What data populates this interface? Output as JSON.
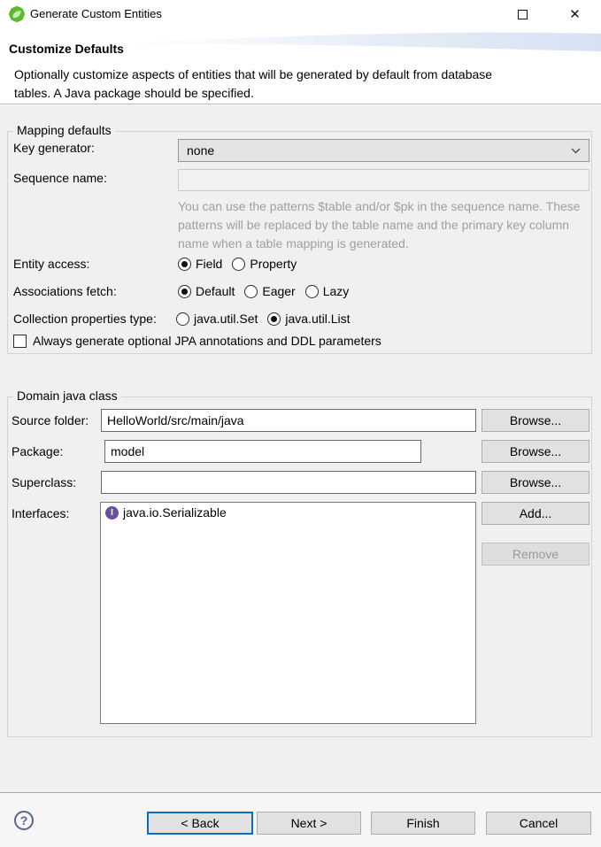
{
  "window": {
    "title": "Generate Custom Entities"
  },
  "icons": {
    "app_icon": "spring-logo",
    "maximize_icon": "Maximize window square",
    "close_icon": "✕",
    "dropdown_chevron_icon": "chevron-down",
    "help_icon": "?",
    "interface_icon_letter": "I"
  },
  "header": {
    "title": "Customize Defaults",
    "description": "Optionally customize aspects of entities that will be generated by default from database tables. A Java package should be specified."
  },
  "mapping_defaults": {
    "legend": "Mapping defaults",
    "key_generator": {
      "label": "Key generator:",
      "value": "none"
    },
    "sequence_name": {
      "label": "Sequence name:",
      "value": "",
      "enabled": false
    },
    "sequence_hint": "You can use the patterns $table and/or $pk in the sequence name. These patterns will be replaced by the table name and the primary key column name when a table mapping is generated.",
    "entity_access": {
      "label": "Entity access:",
      "options": [
        {
          "label": "Field",
          "selected": true
        },
        {
          "label": "Property",
          "selected": false
        }
      ]
    },
    "associations_fetch": {
      "label": "Associations fetch:",
      "options": [
        {
          "label": "Default",
          "selected": true
        },
        {
          "label": "Eager",
          "selected": false
        },
        {
          "label": "Lazy",
          "selected": false
        }
      ]
    },
    "collection_properties_type": {
      "label": "Collection properties type:",
      "options": [
        {
          "label": "java.util.Set",
          "selected": false
        },
        {
          "label": "java.util.List",
          "selected": true
        }
      ]
    },
    "jpa_checkbox": {
      "label": "Always generate optional JPA annotations and DDL parameters",
      "checked": false
    }
  },
  "domain_java_class": {
    "legend": "Domain java class",
    "source_folder": {
      "label": "Source folder:",
      "value": "HelloWorld/src/main/java",
      "button": "Browse..."
    },
    "package": {
      "label": "Package:",
      "value": "model",
      "button": "Browse..."
    },
    "superclass": {
      "label": "Superclass:",
      "value": "",
      "button": "Browse..."
    },
    "interfaces": {
      "label": "Interfaces:",
      "items": [
        {
          "icon": "interface-icon",
          "label": "java.io.Serializable"
        }
      ],
      "add_button": "Add...",
      "remove_button": "Remove",
      "remove_enabled": false
    }
  },
  "footer": {
    "back_label": "< Back",
    "back_focused": true,
    "next_label": "Next >",
    "finish_label": "Finish",
    "cancel_label": "Cancel"
  },
  "colors": {
    "accent_focus": "#0a6cc4",
    "content_background": "#f0f0f0",
    "hint_text": "#9f9f9f",
    "spring_green": "#5fb832",
    "interface_purple": "#6b4fa0",
    "disabled_text": "#9a9a9a"
  }
}
